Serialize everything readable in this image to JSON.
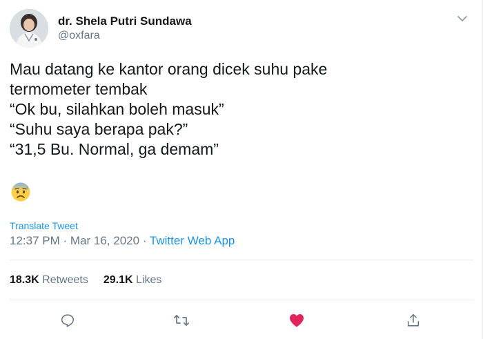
{
  "tweet": {
    "author": {
      "display_name": "dr. Shela Putri Sundawa",
      "handle": "@oxfara"
    },
    "text_lines": [
      "Mau datang ke kantor orang dicek suhu pake",
      "termometer tembak",
      "“Ok bu, silahkan boleh masuk”",
      "“Suhu saya berapa pak?”",
      "“31,5 Bu. Normal, ga demam”"
    ],
    "emoji": "anxious-face-with-sweat",
    "translate_label": "Translate Tweet",
    "time": "12:37 PM",
    "date": "Mar 16, 2020",
    "separator": "·",
    "source_app": "Twitter Web App",
    "stats": {
      "retweets_count": "18.3K",
      "retweets_label": "Retweets",
      "likes_count": "29.1K",
      "likes_label": "Likes"
    },
    "actions": {
      "reply": "reply-icon",
      "retweet": "retweet-icon",
      "like": "heart-icon",
      "share": "share-icon"
    },
    "colors": {
      "link_blue": "#1b95e0",
      "secondary_text": "#657786",
      "like_red": "#e0245e",
      "icon_gray": "#657786"
    }
  }
}
